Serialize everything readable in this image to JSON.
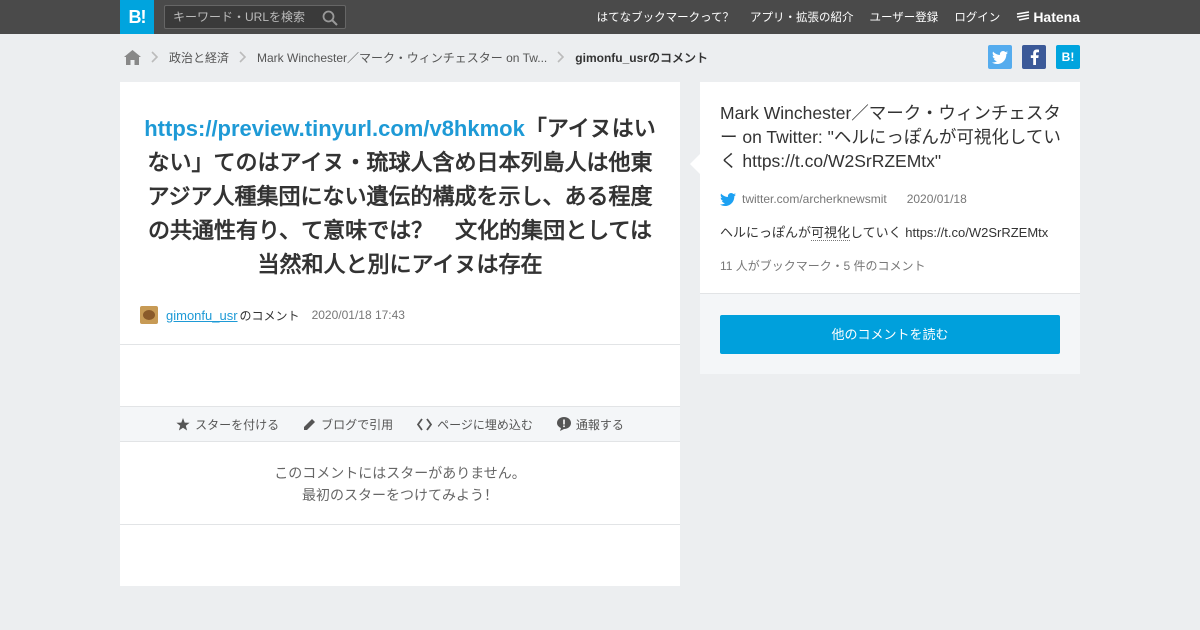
{
  "header": {
    "logo": "B!",
    "search_placeholder": "キーワード・URLを検索",
    "nav": [
      "はてなブックマークって？",
      "アプリ・拡張の紹介",
      "ユーザー登録",
      "ログイン"
    ],
    "brand": "Hatena"
  },
  "breadcrumb": {
    "items": [
      "政治と経済",
      "Mark Winchester／マーク・ウィンチェスター on Tw...",
      "gimonfu_usrのコメント"
    ]
  },
  "share": {
    "twitter_color": "#55acee",
    "facebook_color": "#3b5998",
    "hatena_color": "#00a4de",
    "hatena_label": "B!"
  },
  "comment": {
    "link": "https://preview.tinyurl.com/v8hkmok",
    "text": "「アイヌはいない」てのはアイヌ・琉球人含め日本列島人は他東アジア人種集団にない遺伝的構成を示し、ある程度の共通性有り、て意味では？　文化的集団としては当然和人と別にアイヌは存在",
    "user": "gimonfu_usr",
    "user_suffix": "のコメント",
    "datetime": "2020/01/18 17:43"
  },
  "actions": [
    "スターを付ける",
    "ブログで引用",
    "ページに埋め込む",
    "通報する"
  ],
  "no_star": {
    "line1": "このコメントにはスターがありません。",
    "line2": "最初のスターをつけてみよう！"
  },
  "entry": {
    "title": "Mark Winchester／マーク・ウィンチェスター on Twitter: \"ヘルにっぽんが可視化していく https://t.co/W2SrRZEMtx\"",
    "source": "twitter.com/archerknewsmit",
    "date": "2020/01/18",
    "desc_before": "ヘルにっぽんが",
    "desc_highlight": "可視化",
    "desc_after": "していく https://t.co/W2SrRZEMtx",
    "stats": "11 人がブックマーク・5 件のコメント",
    "more_button": "他のコメントを読む"
  },
  "colors": {
    "accent": "#00a4de",
    "link": "#1e9ad6"
  }
}
